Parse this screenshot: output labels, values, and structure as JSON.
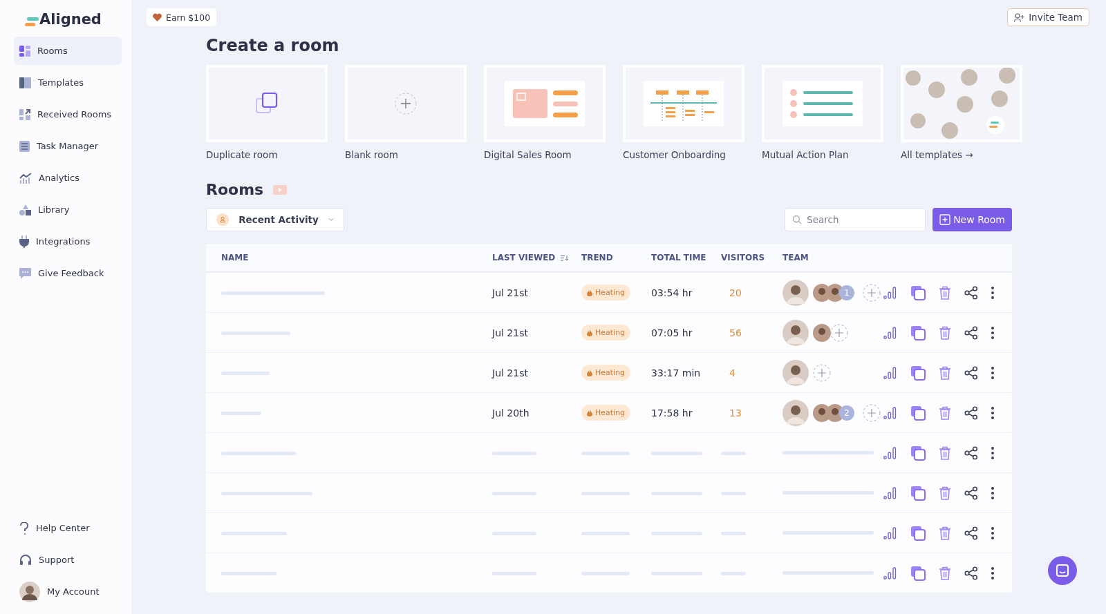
{
  "logo": "Aligned",
  "sidebar": {
    "items": [
      {
        "label": "Rooms",
        "kind": "grid",
        "selected": true
      },
      {
        "label": "Templates",
        "kind": "book",
        "selected": false
      },
      {
        "label": "Received Rooms",
        "kind": "received",
        "selected": false
      },
      {
        "label": "Task Manager",
        "kind": "list",
        "selected": false
      },
      {
        "label": "Analytics",
        "kind": "chart",
        "selected": false
      },
      {
        "label": "Library",
        "kind": "shapes",
        "selected": false
      },
      {
        "label": "Integrations",
        "kind": "plug",
        "selected": false
      },
      {
        "label": "Give Feedback",
        "kind": "chat",
        "selected": false
      }
    ],
    "footer": [
      {
        "label": "Help Center",
        "kind": "help"
      },
      {
        "label": "Support",
        "kind": "headset"
      },
      {
        "label": "My Account",
        "kind": "account"
      }
    ]
  },
  "earn_button": "Earn $100",
  "invite_button": "Invite Team",
  "create_title": "Create a room",
  "create_cards": [
    {
      "label": "Duplicate room",
      "kind": "duplicate"
    },
    {
      "label": "Blank room",
      "kind": "blank"
    },
    {
      "label": "Digital Sales Room",
      "kind": "sales"
    },
    {
      "label": "Customer Onboarding",
      "kind": "onboarding"
    },
    {
      "label": "Mutual Action Plan",
      "kind": "plan"
    },
    {
      "label": "All templates",
      "arrow": "→",
      "kind": "gallery"
    }
  ],
  "rooms_title": "Rooms",
  "filter": {
    "value": "Recent Activity"
  },
  "search": {
    "placeholder": "Search"
  },
  "new_room_button": "New Room",
  "table": {
    "columns": [
      "NAME",
      "LAST VIEWED",
      "TREND",
      "TOTAL TIME",
      "VISITORS",
      "TEAM"
    ],
    "rows": [
      {
        "kind": "room",
        "last_viewed": "Jul 21st",
        "trend": "Heating",
        "total_time": "03:54 hr",
        "visitors": "20",
        "team": {
          "members": [
            {
              "kind": "member"
            },
            {
              "kind": "member"
            }
          ],
          "more": "1"
        }
      },
      {
        "kind": "room",
        "last_viewed": "Jul 21st",
        "trend": "Heating",
        "total_time": "07:05 hr",
        "visitors": "56",
        "team": {
          "members": [
            {
              "kind": "member"
            }
          ]
        }
      },
      {
        "kind": "room",
        "last_viewed": "Jul 21st",
        "trend": "Heating",
        "total_time": "33:17 min",
        "visitors": "4",
        "team": {}
      },
      {
        "kind": "room",
        "last_viewed": "Jul 20th",
        "trend": "Heating",
        "total_time": "17:58 hr",
        "visitors": "13",
        "team": {
          "members": [
            {
              "kind": "member"
            },
            {
              "kind": "member"
            }
          ],
          "more": "2"
        }
      },
      {
        "kind": "loading"
      },
      {
        "kind": "loading"
      },
      {
        "kind": "loading"
      },
      {
        "kind": "loading"
      }
    ]
  }
}
